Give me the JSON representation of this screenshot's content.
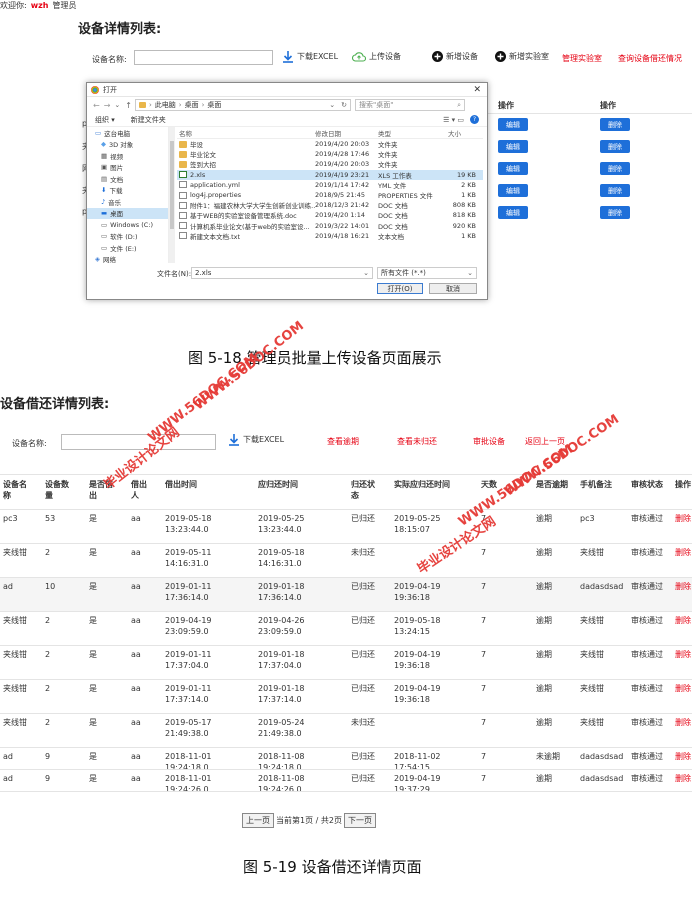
{
  "topbar": {
    "welcome": "欢迎你:",
    "user": "wzh",
    "role": "管理员"
  },
  "s1": {
    "title": "设备详情列表:",
    "name_label": "设备名称:",
    "download": "下载EXCEL",
    "upload": "上传设备",
    "add_device": "新增设备",
    "add_lab": "新增实验室",
    "manage_lab": "管理实验室",
    "query_borrow": "查询设备借还情况",
    "col_op": "操作",
    "edit": "编辑",
    "delete": "删除",
    "edge_rows": [
      "p",
      "夹",
      "网",
      "夹",
      "p"
    ]
  },
  "dialog": {
    "title": "打开",
    "breadcrumb": [
      "此电脑",
      "桌面",
      "桌面"
    ],
    "search_placeholder": "搜索\"桌面\"",
    "organize": "组织 ▾",
    "new_folder": "新建文件夹",
    "nav": [
      "这台电脑",
      "3D 对象",
      "视频",
      "图片",
      "文档",
      "下载",
      "音乐",
      "桌面",
      "Windows (C:)",
      "软件 (D:)",
      "文件 (E:)",
      "网络"
    ],
    "headers": {
      "name": "名称",
      "date": "修改日期",
      "type": "类型",
      "size": "大小"
    },
    "files": [
      {
        "icon": "folder",
        "name": "毕设",
        "date": "2019/4/20 20:03",
        "type": "文件夹",
        "size": ""
      },
      {
        "icon": "folder",
        "name": "毕业论文",
        "date": "2019/4/28 17:46",
        "type": "文件夹",
        "size": ""
      },
      {
        "icon": "folder",
        "name": "签到大招",
        "date": "2019/4/20 20:03",
        "type": "文件夹",
        "size": ""
      },
      {
        "icon": "xls",
        "name": "2.xls",
        "date": "2019/4/19 23:21",
        "type": "XLS 工作表",
        "size": "19 KB"
      },
      {
        "icon": "doc",
        "name": "application.yml",
        "date": "2019/1/14 17:42",
        "type": "YML 文件",
        "size": "2 KB"
      },
      {
        "icon": "doc",
        "name": "log4j.properties",
        "date": "2018/9/5 21:45",
        "type": "PROPERTIES 文件",
        "size": "1 KB"
      },
      {
        "icon": "doc",
        "name": "附件1：福建农林大学大学生创新创业训练...",
        "date": "2018/12/3 21:42",
        "type": "DOC 文档",
        "size": "808 KB"
      },
      {
        "icon": "doc",
        "name": "基于WEB的实验室设备管理系统.doc",
        "date": "2019/4/20 1:14",
        "type": "DOC 文档",
        "size": "818 KB"
      },
      {
        "icon": "doc",
        "name": "计算机系毕业论文(基于web的实验室设...",
        "date": "2019/3/22 14:01",
        "type": "DOC 文档",
        "size": "920 KB"
      },
      {
        "icon": "doc",
        "name": "新建文本文档.txt",
        "date": "2019/4/18 16:21",
        "type": "文本文档",
        "size": "1 KB"
      }
    ],
    "filename_label": "文件名(N):",
    "filename": "2.xls",
    "filter": "所有文件 (*.*)",
    "open": "打开(O)",
    "cancel": "取消"
  },
  "caption1": "图 5-18 管理员批量上传设备页面展示",
  "s2": {
    "title": "设备借还详情列表:",
    "name_label": "设备名称:",
    "download": "下载EXCEL",
    "links": [
      "查看逾期",
      "查看未归还",
      "审批设备",
      "返回上一页"
    ],
    "columns": [
      "设备名\n称",
      "设备数\n量",
      "是否借\n出",
      "借出\n人",
      "借出时间",
      "应归还时间",
      "归还状\n态",
      "实际应归还时间",
      "天数",
      "是否逾期",
      "手机备注",
      "审核状态",
      "操作"
    ],
    "rows": [
      [
        "pc3",
        "53",
        "是",
        "aa",
        "2019-05-18\n13:23:44.0",
        "2019-05-25\n13:23:44.0",
        "已归还",
        "2019-05-25\n18:15:07",
        "7",
        "逾期",
        "pc3",
        "审核通过",
        "删除"
      ],
      [
        "夹线钳",
        "2",
        "是",
        "aa",
        "2019-05-11 14:16:31.0",
        "2019-05-18\n14:16:31.0",
        "未归还",
        "",
        "7",
        "逾期",
        "夹线钳",
        "审核通过",
        "删除"
      ],
      [
        "ad",
        "10",
        "是",
        "aa",
        "2019-01-11 17:36:14.0",
        "2019-01-18\n17:36:14.0",
        "已归还",
        "2019-04-19\n19:36:18",
        "7",
        "逾期",
        "dadasdsad",
        "审核通过",
        "删除"
      ],
      [
        "夹线钳",
        "2",
        "是",
        "aa",
        "2019-04-19\n23:09:59.0",
        "2019-04-26\n23:09:59.0",
        "已归还",
        "2019-05-18\n13:24:15",
        "7",
        "逾期",
        "夹线钳",
        "审核通过",
        "删除"
      ],
      [
        "夹线钳",
        "2",
        "是",
        "aa",
        "2019-01-11 17:37:04.0",
        "2019-01-18\n17:37:04.0",
        "已归还",
        "2019-04-19\n19:36:18",
        "7",
        "逾期",
        "夹线钳",
        "审核通过",
        "删除"
      ],
      [
        "夹线钳",
        "2",
        "是",
        "aa",
        "2019-01-11 17:37:14.0",
        "2019-01-18\n17:37:14.0",
        "已归还",
        "2019-04-19\n19:36:18",
        "7",
        "逾期",
        "夹线钳",
        "审核通过",
        "删除"
      ],
      [
        "夹线钳",
        "2",
        "是",
        "aa",
        "2019-05-17\n21:49:38.0",
        "2019-05-24\n21:49:38.0",
        "未归还",
        "",
        "7",
        "逾期",
        "夹线钳",
        "审核通过",
        "删除"
      ],
      [
        "ad",
        "9",
        "是",
        "aa",
        "2018-11-01 19:24:18.0",
        "2018-11-08 19:24:18.0",
        "已归还",
        "2018-11-02 17:54:15",
        "7",
        "未逾期",
        "dadasdsad",
        "审核通过",
        "删除"
      ],
      [
        "ad",
        "9",
        "是",
        "aa",
        "2018-11-01 19:24:26.0",
        "2018-11-08 19:24:26.0",
        "已归还",
        "2019-04-19\n19:37:29",
        "7",
        "逾期",
        "dadasdsad",
        "审核通过",
        "删除"
      ]
    ],
    "pager": {
      "prev": "上一页",
      "info": "当前第1页 / 共2页",
      "next": "下一页"
    }
  },
  "caption2": "图 5-19 设备借还详情页面",
  "watermarks": {
    "url": "WWW.56DOC.COM",
    "cn": "毕业设计论文网"
  },
  "colors": {
    "accent_red": "#e60012",
    "button_blue": "#1e6fd9",
    "watermark": "#e53935"
  }
}
